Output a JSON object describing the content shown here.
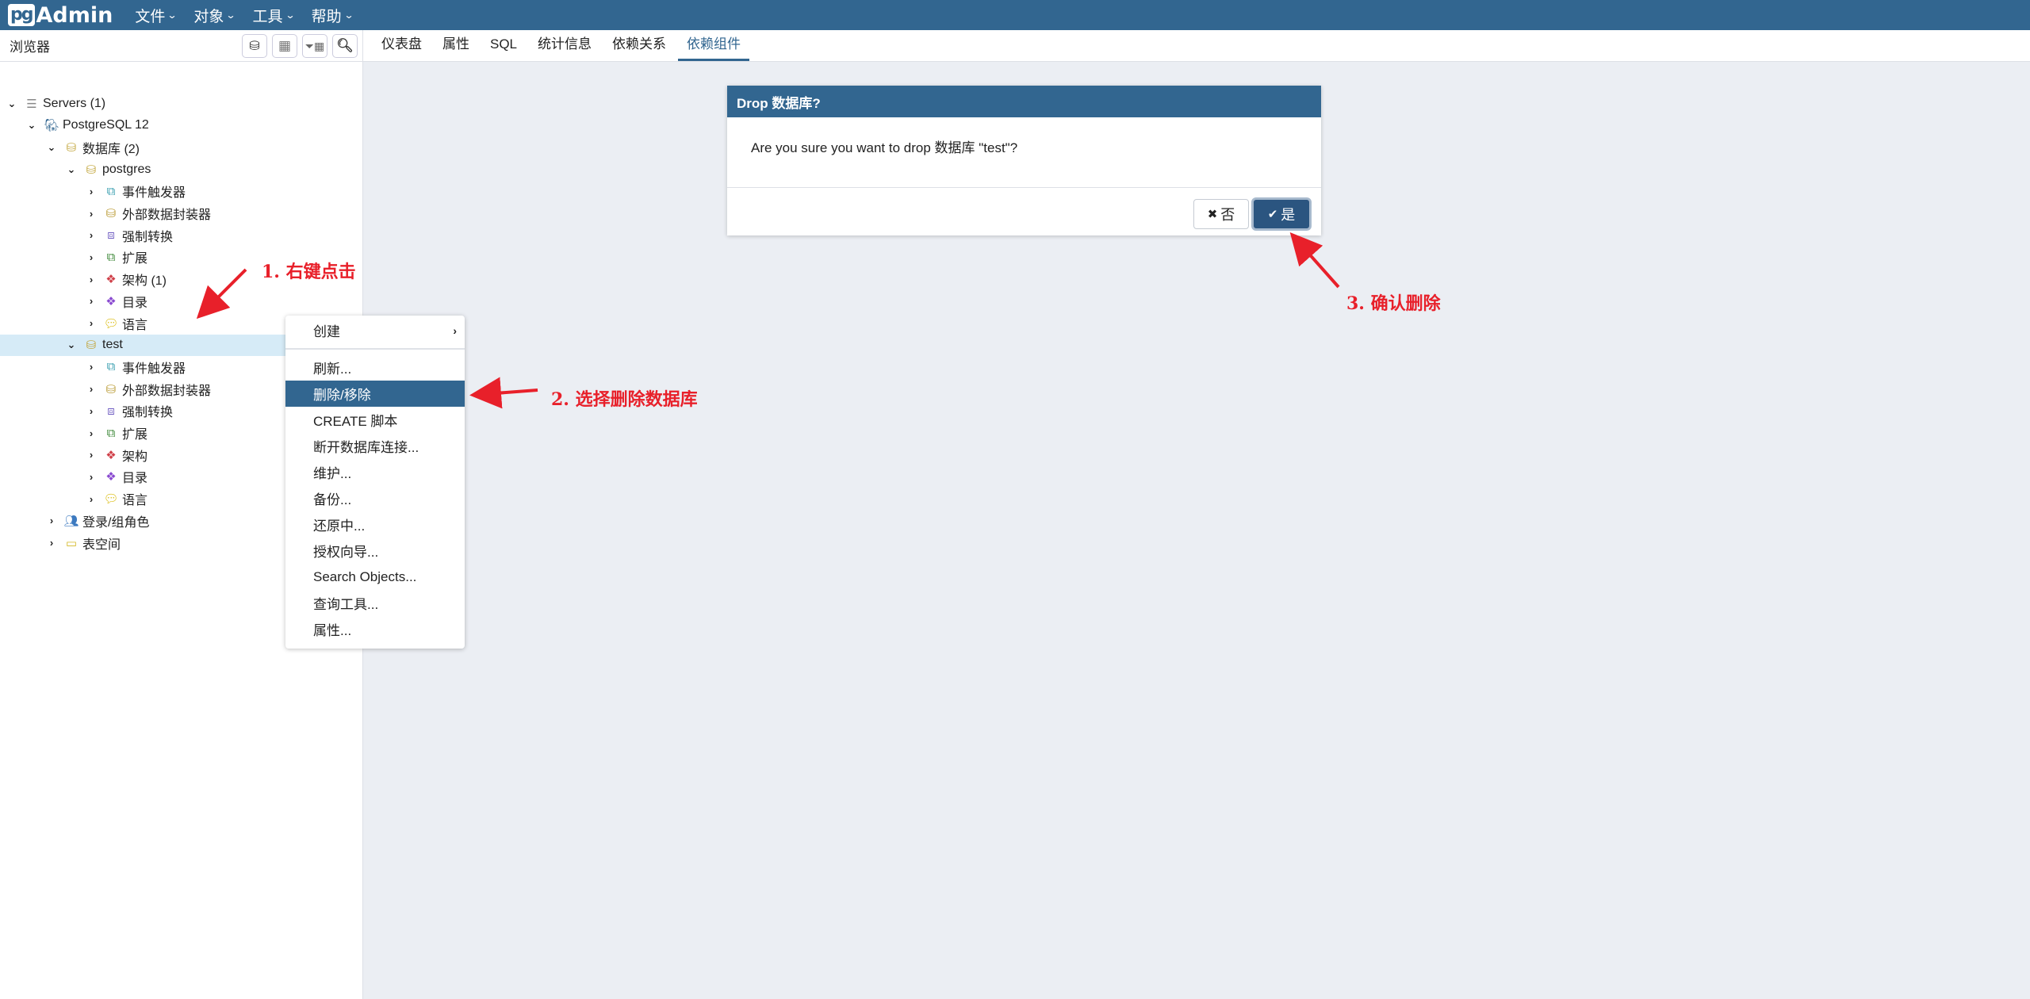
{
  "app": {
    "logo_pg": "pg",
    "logo_name": "Admin"
  },
  "menu": [
    {
      "label": "文件"
    },
    {
      "label": "对象"
    },
    {
      "label": "工具"
    },
    {
      "label": "帮助"
    }
  ],
  "sidebar": {
    "title": "浏览器",
    "tools": [
      {
        "icon": "query-tool-icon"
      },
      {
        "icon": "view-data-icon"
      },
      {
        "icon": "filtered-rows-icon"
      },
      {
        "icon": "search-icon"
      }
    ],
    "tree": [
      {
        "label": "Servers (1)",
        "level": 0,
        "expanded": true,
        "icon": "servers-icon"
      },
      {
        "label": "PostgreSQL 12",
        "level": 1,
        "expanded": true,
        "icon": "postgresql-icon"
      },
      {
        "label": "数据库 (2)",
        "level": 2,
        "expanded": true,
        "icon": "databases-icon"
      },
      {
        "label": "postgres",
        "level": 3,
        "expanded": true,
        "icon": "database-icon"
      },
      {
        "label": "事件触发器",
        "level": 4,
        "expanded": false,
        "icon": "event-trigger-icon"
      },
      {
        "label": "外部数据封装器",
        "level": 4,
        "expanded": false,
        "icon": "fdw-icon"
      },
      {
        "label": "强制转换",
        "level": 4,
        "expanded": false,
        "icon": "cast-icon"
      },
      {
        "label": "扩展",
        "level": 4,
        "expanded": false,
        "icon": "extension-icon"
      },
      {
        "label": "架构 (1)",
        "level": 4,
        "expanded": false,
        "icon": "schema-icon"
      },
      {
        "label": "目录",
        "level": 4,
        "expanded": false,
        "icon": "catalog-icon"
      },
      {
        "label": "语言",
        "level": 4,
        "expanded": false,
        "icon": "language-icon"
      },
      {
        "label": "test",
        "level": 3,
        "expanded": true,
        "icon": "database-icon",
        "selected": true
      },
      {
        "label": "事件触发器",
        "level": 4,
        "expanded": false,
        "icon": "event-trigger-icon"
      },
      {
        "label": "外部数据封装器",
        "level": 4,
        "expanded": false,
        "icon": "fdw-icon"
      },
      {
        "label": "强制转换",
        "level": 4,
        "expanded": false,
        "icon": "cast-icon"
      },
      {
        "label": "扩展",
        "level": 4,
        "expanded": false,
        "icon": "extension-icon"
      },
      {
        "label": "架构",
        "level": 4,
        "expanded": false,
        "icon": "schema-icon"
      },
      {
        "label": "目录",
        "level": 4,
        "expanded": false,
        "icon": "catalog-icon"
      },
      {
        "label": "语言",
        "level": 4,
        "expanded": false,
        "icon": "language-icon"
      },
      {
        "label": "登录/组角色",
        "level": 2,
        "expanded": false,
        "icon": "roles-icon"
      },
      {
        "label": "表空间",
        "level": 2,
        "expanded": false,
        "icon": "tablespace-icon"
      }
    ]
  },
  "tabs": [
    {
      "label": "仪表盘"
    },
    {
      "label": "属性"
    },
    {
      "label": "SQL"
    },
    {
      "label": "统计信息"
    },
    {
      "label": "依赖关系"
    },
    {
      "label": "依赖组件",
      "active": true
    }
  ],
  "context_menu": {
    "items": [
      {
        "label": "创建",
        "submenu": true
      },
      {
        "separator": true
      },
      {
        "label": "刷新..."
      },
      {
        "label": "删除/移除",
        "highlighted": true
      },
      {
        "label": "CREATE 脚本"
      },
      {
        "label": "断开数据库连接..."
      },
      {
        "label": "维护..."
      },
      {
        "label": "备份..."
      },
      {
        "label": "还原中..."
      },
      {
        "label": "授权向导..."
      },
      {
        "label": "Search Objects..."
      },
      {
        "label": "查询工具..."
      },
      {
        "label": "属性..."
      }
    ]
  },
  "dialog": {
    "title": "Drop 数据库?",
    "message": "Are you sure you want to drop 数据库 \"test\"?",
    "no_label": "否",
    "yes_label": "是"
  },
  "annotations": [
    {
      "text": "1. 右键点击"
    },
    {
      "text": "2. 选择删除数据库"
    },
    {
      "text": "3. 确认删除"
    }
  ],
  "colors": {
    "brand": "#326690",
    "selected_row": "#d6ebf7",
    "annotation": "#e8202a",
    "background": "#ebeef3"
  }
}
